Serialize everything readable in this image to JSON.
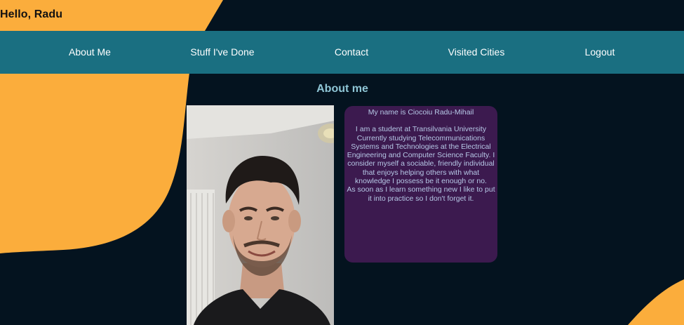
{
  "header": {
    "greeting": "Hello, Radu"
  },
  "nav": {
    "items": [
      {
        "label": "About Me"
      },
      {
        "label": "Stuff I've Done"
      },
      {
        "label": "Contact"
      },
      {
        "label": "Visited Cities"
      },
      {
        "label": "Logout"
      }
    ]
  },
  "about": {
    "title": "About me",
    "bio": {
      "name_line": "My name is Ciocoiu Radu-Mihail",
      "paragraph_1": "I am a student at Transilvania University Currently studying Telecommunications Systems and Technologies at the Electrical Engineering and Computer Science Faculty. I consider myself a sociable, friendly individual that enjoys helping others with what knowledge I possess be it enough or no.",
      "paragraph_2": "As soon as I learn something new I like to put it into practice so I don't forget it."
    }
  },
  "colors": {
    "background": "#04131f",
    "accent_orange": "#fbad3c",
    "navbar": "#1a6f81",
    "card": "#3c1a4f",
    "title": "#8fc6d6"
  }
}
